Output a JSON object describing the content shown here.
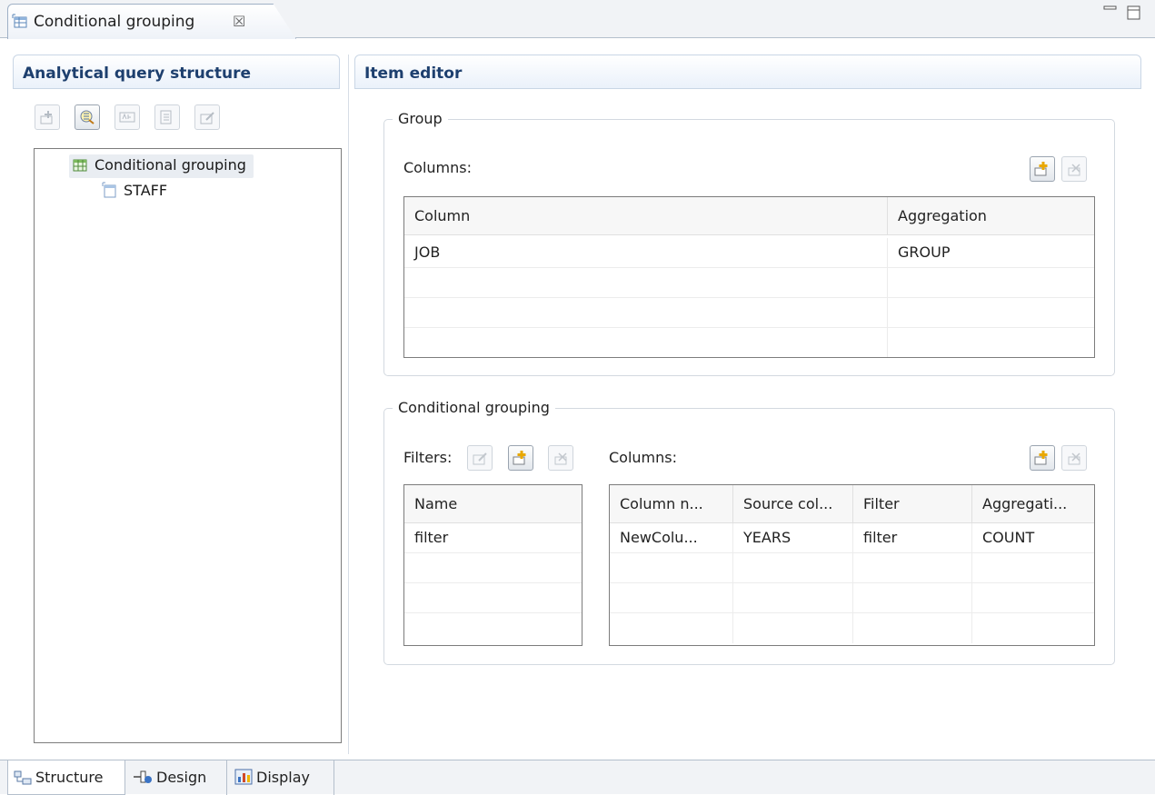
{
  "editor_tab": {
    "title": "Conditional grouping",
    "close_glyph": "☒"
  },
  "left_panel": {
    "title": "Analytical query structure",
    "toolbar": [
      "add-item-icon",
      "query-icon",
      "rename-icon",
      "properties-icon",
      "edit-icon"
    ],
    "tree": [
      {
        "label": "Conditional grouping",
        "icon": "grouping-table-icon",
        "selected": true
      },
      {
        "label": "STAFF",
        "icon": "table-icon",
        "selected": false
      }
    ]
  },
  "item_editor": {
    "title": "Item editor",
    "group": {
      "legend": "Group",
      "columns_label": "Columns:",
      "table": {
        "headers": [
          "Column",
          "Aggregation"
        ],
        "rows": [
          [
            "JOB",
            "GROUP"
          ],
          [
            "",
            ""
          ],
          [
            "",
            ""
          ],
          [
            "",
            ""
          ]
        ]
      }
    },
    "conditional_grouping": {
      "legend": "Conditional grouping",
      "filters_label": "Filters:",
      "columns_label": "Columns:",
      "filters_table": {
        "headers": [
          "Name"
        ],
        "rows": [
          [
            "filter"
          ],
          [
            ""
          ],
          [
            ""
          ],
          [
            ""
          ]
        ]
      },
      "columns_table": {
        "headers": [
          "Column n...",
          "Source col...",
          "Filter",
          "Aggregati..."
        ],
        "rows": [
          [
            "NewColu...",
            "YEARS",
            "filter",
            "COUNT"
          ],
          [
            "",
            "",
            "",
            ""
          ],
          [
            "",
            "",
            "",
            ""
          ],
          [
            "",
            "",
            "",
            ""
          ]
        ]
      }
    }
  },
  "bottom_tabs": [
    {
      "label": "Structure",
      "icon": "structure-icon",
      "active": true
    },
    {
      "label": "Design",
      "icon": "design-icon",
      "active": false
    },
    {
      "label": "Display",
      "icon": "display-chart-icon",
      "active": false
    }
  ]
}
